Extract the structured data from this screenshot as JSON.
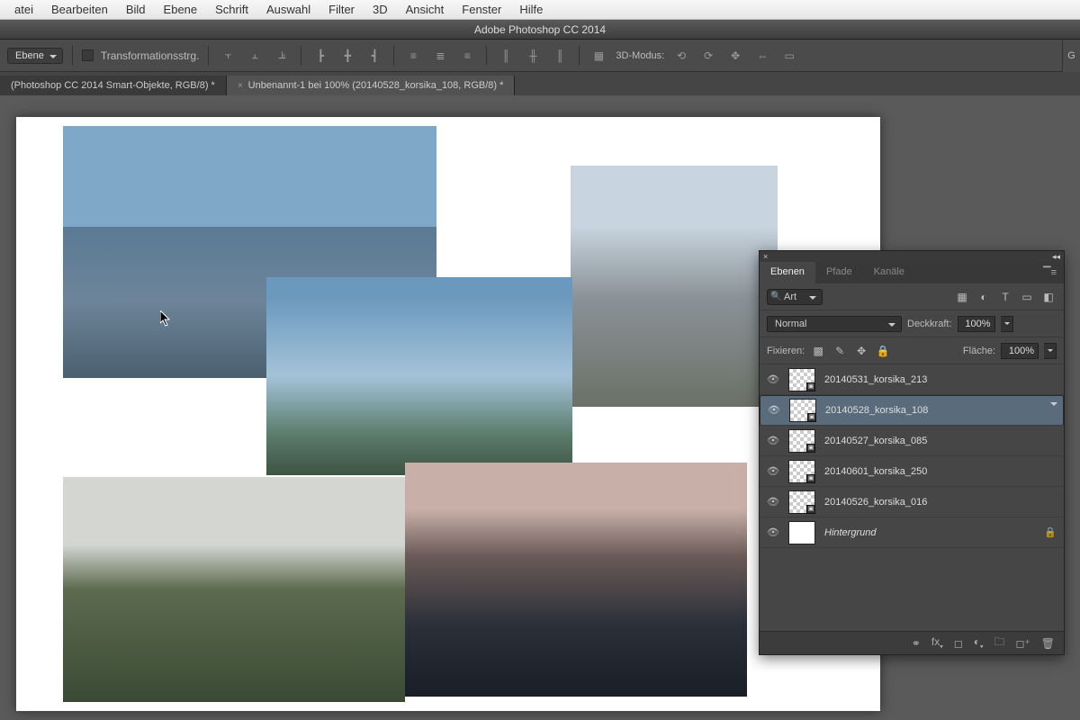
{
  "menubar": [
    "atei",
    "Bearbeiten",
    "Bild",
    "Ebene",
    "Schrift",
    "Auswahl",
    "Filter",
    "3D",
    "Ansicht",
    "Fenster",
    "Hilfe"
  ],
  "titlebar": "Adobe Photoshop CC 2014",
  "optbar": {
    "layer_select": "Ebene",
    "transform_chk": "Transformationsstrg.",
    "mode3d": "3D-Modus:"
  },
  "right_trunc": "G",
  "tabs": [
    {
      "label": "(Photoshop CC 2014  Smart-Objekte, RGB/8) *",
      "active": false
    },
    {
      "label": "Unbenannt-1 bei 100% (20140528_korsika_108, RGB/8) *",
      "active": true
    }
  ],
  "panel": {
    "tabs": [
      "Ebenen",
      "Pfade",
      "Kanäle"
    ],
    "active_tab": 0,
    "kind": "Art",
    "blend": "Normal",
    "opacity_label": "Deckkraft:",
    "opacity": "100%",
    "lock_label": "Fixieren:",
    "fill_label": "Fläche:",
    "fill": "100%",
    "layers": [
      {
        "name": "20140531_korsika_213",
        "smart": true,
        "bg": false,
        "selected": false
      },
      {
        "name": "20140528_korsika_108",
        "smart": true,
        "bg": false,
        "selected": true
      },
      {
        "name": "20140527_korsika_085",
        "smart": true,
        "bg": false,
        "selected": false
      },
      {
        "name": "20140601_korsika_250",
        "smart": true,
        "bg": false,
        "selected": false
      },
      {
        "name": "20140526_korsika_016",
        "smart": true,
        "bg": false,
        "selected": false
      },
      {
        "name": "Hintergrund",
        "smart": false,
        "bg": true,
        "selected": false,
        "locked": true
      }
    ]
  }
}
